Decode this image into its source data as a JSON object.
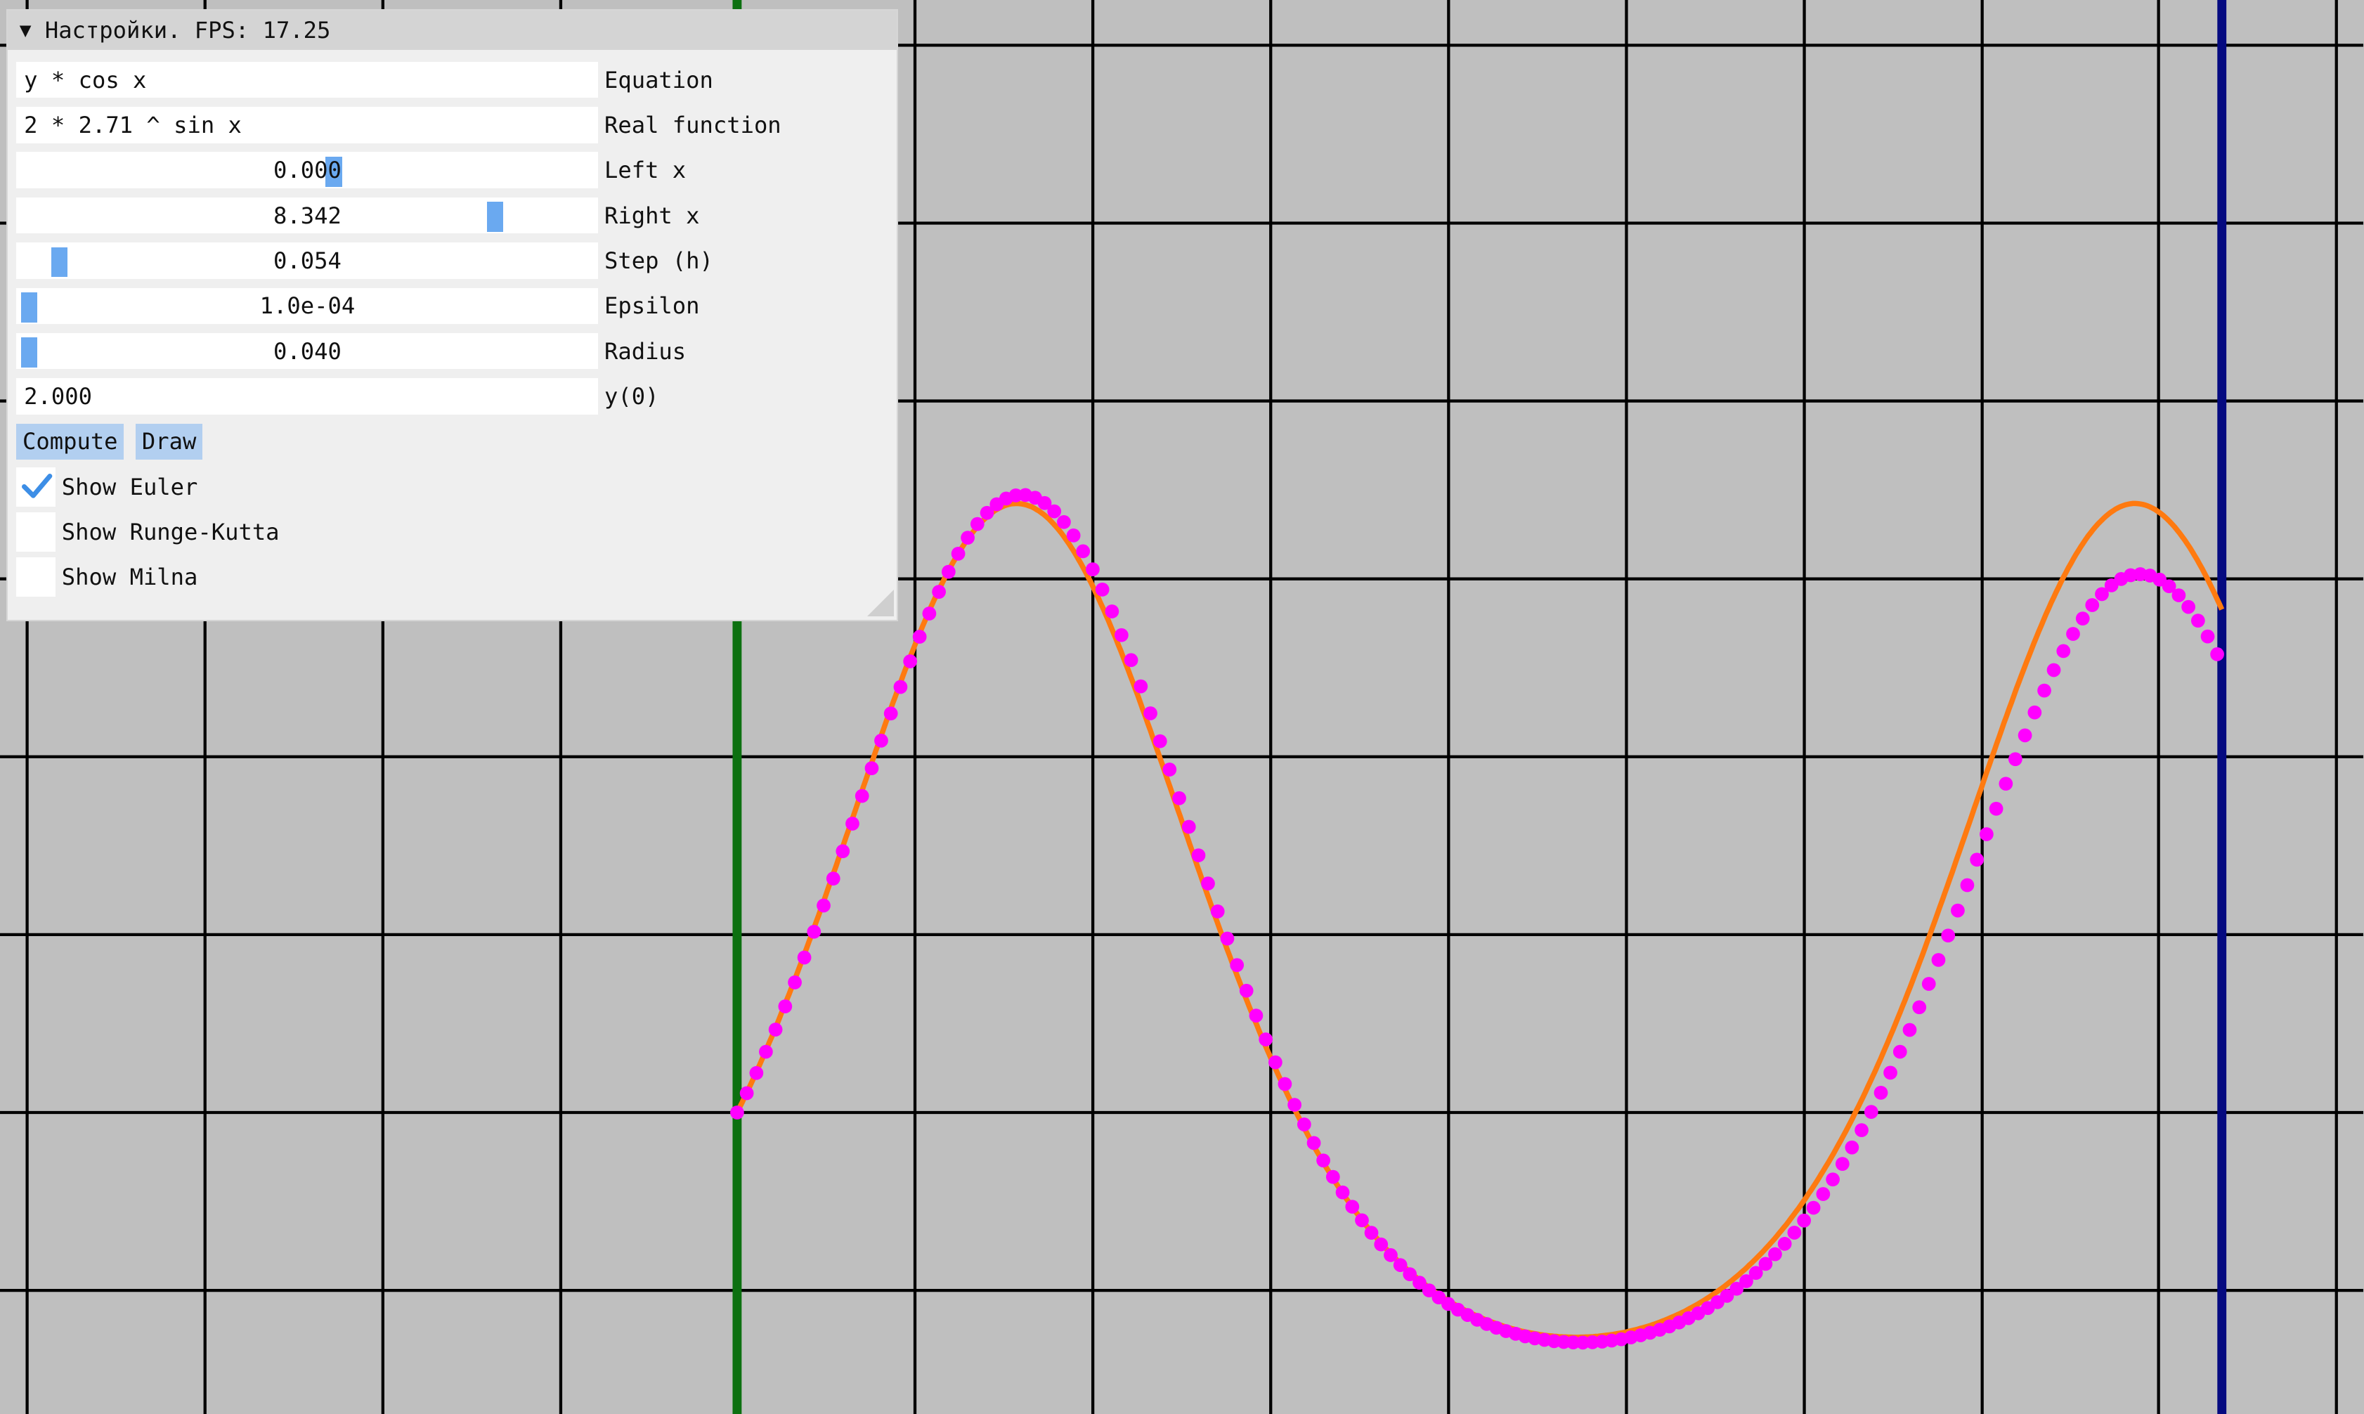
{
  "window": {
    "title": "Настройки. FPS: 17.25"
  },
  "fields": {
    "equation": {
      "value": "y * cos x",
      "label": "Equation"
    },
    "real_function": {
      "value": "2 * 2.71 ^ sin x",
      "label": "Real function"
    },
    "left_x": {
      "value": "0.000",
      "label": "Left x"
    },
    "right_x": {
      "value": "8.342",
      "label": "Right x"
    },
    "step_h": {
      "value": "0.054",
      "label": "Step (h)"
    },
    "epsilon": {
      "value": "1.0e-04",
      "label": "Epsilon"
    },
    "radius": {
      "value": "0.040",
      "label": "Radius"
    },
    "y0": {
      "value": "2.000",
      "label": "y(0)"
    }
  },
  "buttons": {
    "compute": "Compute",
    "draw": "Draw"
  },
  "checkboxes": [
    {
      "label": "Show Euler",
      "checked": true
    },
    {
      "label": "Show Runge-Kutta",
      "checked": false
    },
    {
      "label": "Show Milna",
      "checked": false
    }
  ],
  "colors": {
    "background": "#bfbfbf",
    "grid": "#000000",
    "left_bound": "#0c7010",
    "right_bound": "#050a80",
    "real_curve": "#ff7a10",
    "euler_points": "#ff00ff",
    "slider_grab": "#6aa9f0"
  },
  "chart_data": {
    "type": "line",
    "x_range": [
      0.0,
      8.342
    ],
    "step": 0.054,
    "initial_value": 2.0,
    "series": [
      {
        "function": "2 * 2.71 ^ sin x",
        "style": "line"
      },
      {
        "method": "euler",
        "style": "scatter"
      }
    ]
  }
}
